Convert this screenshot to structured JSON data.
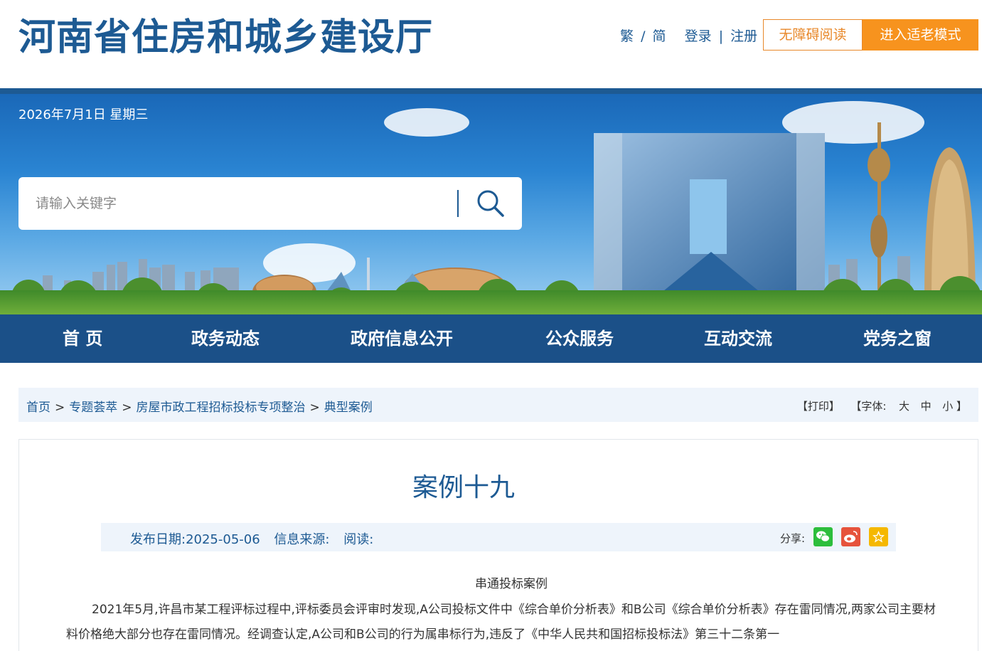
{
  "header": {
    "site_title": "河南省住房和城乡建设厅",
    "lang_traditional": "繁",
    "lang_sep": "/",
    "lang_simplified": "简",
    "login": "登录",
    "link_sep": "|",
    "register": "注册",
    "accessible_label": "无障碍阅读",
    "elder_mode_label": "进入适老模式"
  },
  "banner": {
    "date": "2026年7月1日 星期三",
    "search_placeholder": "请输入关键字"
  },
  "nav": {
    "items": [
      "首 页",
      "政务动态",
      "政府信息公开",
      "公众服务",
      "互动交流",
      "党务之窗"
    ]
  },
  "breadcrumb": {
    "items": [
      "首页",
      "专题荟萃",
      "房屋市政工程招标投标专项整治",
      "典型案例"
    ],
    "arrow": ">",
    "print": "【打印】",
    "font_prefix": "【字体:",
    "font_large": "大",
    "font_medium": "中",
    "font_small": "小",
    "font_suffix": "】"
  },
  "article": {
    "title": "案例十九",
    "publish_date": "发布日期:2025-05-06",
    "source": "信息来源:",
    "views": "阅读:",
    "share_label": "分享:",
    "heading": "串通投标案例",
    "paragraph": "2021年5月,许昌市某工程评标过程中,评标委员会评审时发现,A公司投标文件中《综合单价分析表》和B公司《综合单价分析表》存在雷同情况,两家公司主要材料价格绝大部分也存在雷同情况。经调查认定,A公司和B公司的行为属串标行为,违反了《中华人民共和国招标投标法》第三十二条第一"
  },
  "colors": {
    "brand_blue": "#1d5a93",
    "nav_bg": "#1b5088",
    "orange": "#f7931e",
    "light_bg": "#eef4fb",
    "wechat_green": "#2dbe3c",
    "weibo_red": "#e6533c",
    "favorite_gold": "#f5b800"
  },
  "icons": {
    "search": "search-icon",
    "wechat": "wechat-icon",
    "weibo": "weibo-icon",
    "favorite": "star-icon"
  }
}
